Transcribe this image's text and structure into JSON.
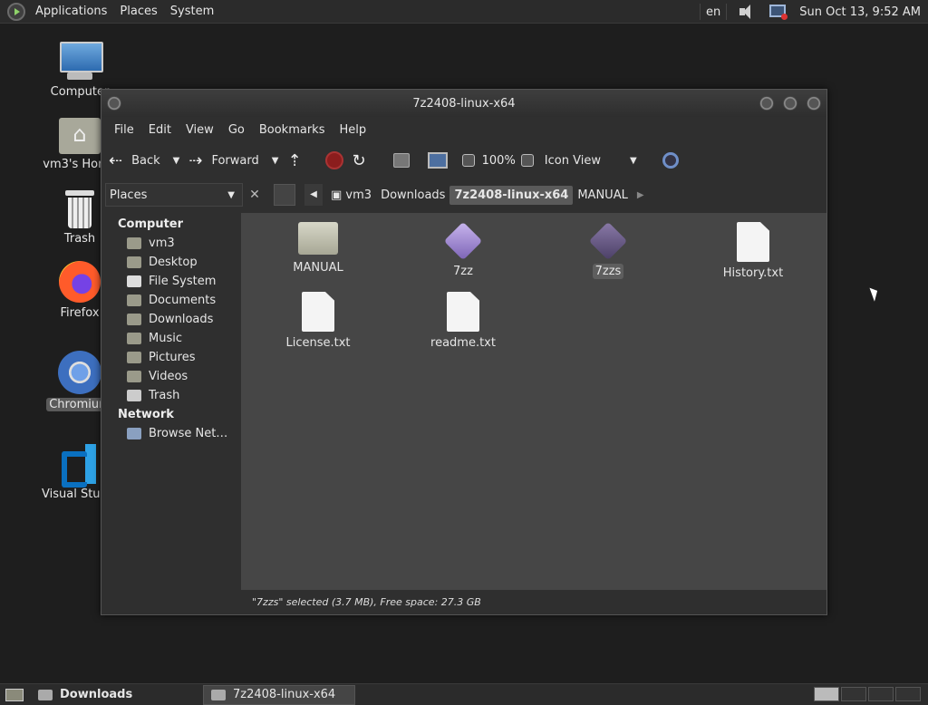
{
  "top_panel": {
    "menus": [
      "Applications",
      "Places",
      "System"
    ],
    "keyboard_layout": "en",
    "datetime": "Sun Oct 13,  9:52 AM"
  },
  "desktop_icons": [
    {
      "label": "Computer",
      "icon": "computer-icon"
    },
    {
      "label": "vm3's Home",
      "icon": "home-folder-icon"
    },
    {
      "label": "Trash",
      "icon": "trash-icon"
    },
    {
      "label": "Firefox",
      "icon": "firefox-icon"
    },
    {
      "label": "Chromium",
      "icon": "chromium-icon"
    },
    {
      "label": "Visual Studio",
      "icon": "vscode-icon"
    }
  ],
  "window": {
    "title": "7z2408-linux-x64",
    "menu": [
      "File",
      "Edit",
      "View",
      "Go",
      "Bookmarks",
      "Help"
    ],
    "toolbar": {
      "back": "Back",
      "forward": "Forward",
      "zoom": "100%",
      "view_mode": "Icon View"
    },
    "places_header": "Places",
    "path": [
      "vm3",
      "Downloads",
      "7z2408-linux-x64",
      "MANUAL"
    ],
    "sidebar": {
      "computer_header": "Computer",
      "computer_items": [
        "vm3",
        "Desktop",
        "File System",
        "Documents",
        "Downloads",
        "Music",
        "Pictures",
        "Videos",
        "Trash"
      ],
      "network_header": "Network",
      "network_items": [
        "Browse Net…"
      ]
    },
    "files": [
      {
        "name": "MANUAL",
        "type": "folder"
      },
      {
        "name": "7zz",
        "type": "executable"
      },
      {
        "name": "7zzs",
        "type": "executable",
        "selected": true
      },
      {
        "name": "History.txt",
        "type": "text"
      },
      {
        "name": "License.txt",
        "type": "text"
      },
      {
        "name": "readme.txt",
        "type": "text"
      }
    ],
    "status": "\"7zzs\" selected (3.7 MB), Free space: 27.3 GB"
  },
  "taskbar": {
    "tasks": [
      "Downloads",
      "7z2408-linux-x64"
    ]
  }
}
